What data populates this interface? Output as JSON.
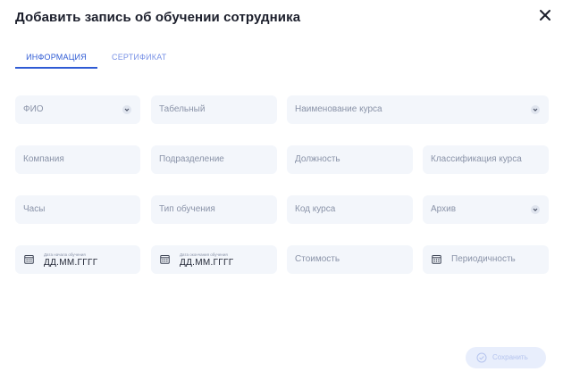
{
  "dialog": {
    "title": "Добавить запись об обучении сотрудника"
  },
  "tabs": [
    {
      "label": "ИНФОРМАЦИЯ",
      "active": true
    },
    {
      "label": "СЕРТИФИКАТ",
      "active": false
    }
  ],
  "form": {
    "fio": "ФИО",
    "tabel": "Табельный",
    "course_name": "Наименование курса",
    "company": "Компания",
    "department": "Подразделение",
    "position": "Должность",
    "course_class": "Классификация курса",
    "hours": "Часы",
    "training_type": "Тип обучения",
    "course_code": "Код курса",
    "archive": "Архив",
    "start_date": {
      "label": "Дата начала обучения",
      "value": "ДД.ММ.ГГГГ"
    },
    "end_date": {
      "label": "Дата окончания обучения",
      "value": "ДД.ММ.ГГГГ"
    },
    "cost": "Стоимость",
    "periodicity": "Периодичность"
  },
  "actions": {
    "save_label": "Сохранить"
  },
  "colors": {
    "accent": "#2f5bd4",
    "field_bg": "#f3f6fb",
    "placeholder": "#8a93a8"
  }
}
